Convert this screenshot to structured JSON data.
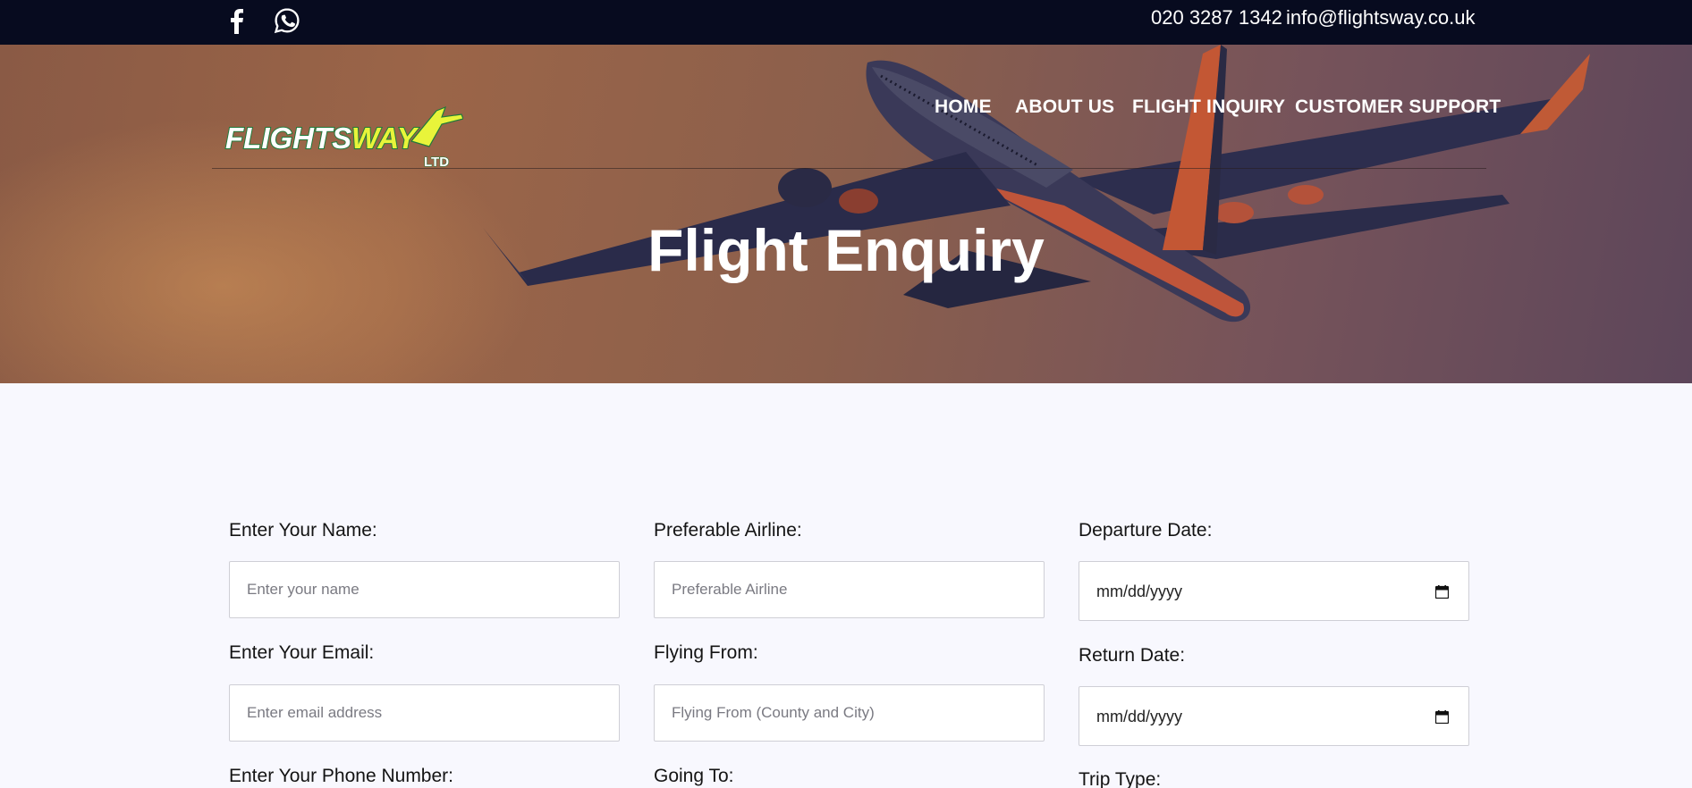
{
  "topbar": {
    "phone": "020 3287 1342",
    "email": "info@flightsway.co.uk",
    "social": [
      "facebook-icon",
      "whatsapp-icon"
    ]
  },
  "brand": {
    "logo_main": "FLIGHTS WAY",
    "logo_sub": "LTD",
    "colors": {
      "flights": "#ffffff",
      "way": "#e8f43a",
      "outline": "#1f7a3a"
    }
  },
  "nav": {
    "home": "HOME",
    "about": "ABOUT US",
    "inquiry": "FLIGHT INQUIRY",
    "support": "CUSTOMER SUPPORT"
  },
  "hero": {
    "title": "Flight Enquiry"
  },
  "form": {
    "name_label": "Enter Your Name:",
    "name_placeholder": "Enter your name",
    "email_label": "Enter Your Email:",
    "email_placeholder": "Enter email address",
    "phone_label": "Enter Your Phone Number:",
    "airline_label": "Preferable Airline:",
    "airline_placeholder": "Preferable Airline",
    "from_label": "Flying From:",
    "from_placeholder": "Flying From (County and City)",
    "to_label": "Going To:",
    "departure_label": "Departure Date:",
    "departure_value": "mm/dd/yyyy",
    "return_label": "Return Date:",
    "return_value": "mm/dd/yyyy",
    "trip_type_label": "Trip Type:"
  },
  "colors": {
    "topbar_bg": "#070b1f",
    "page_bg": "#f8f8fe"
  }
}
